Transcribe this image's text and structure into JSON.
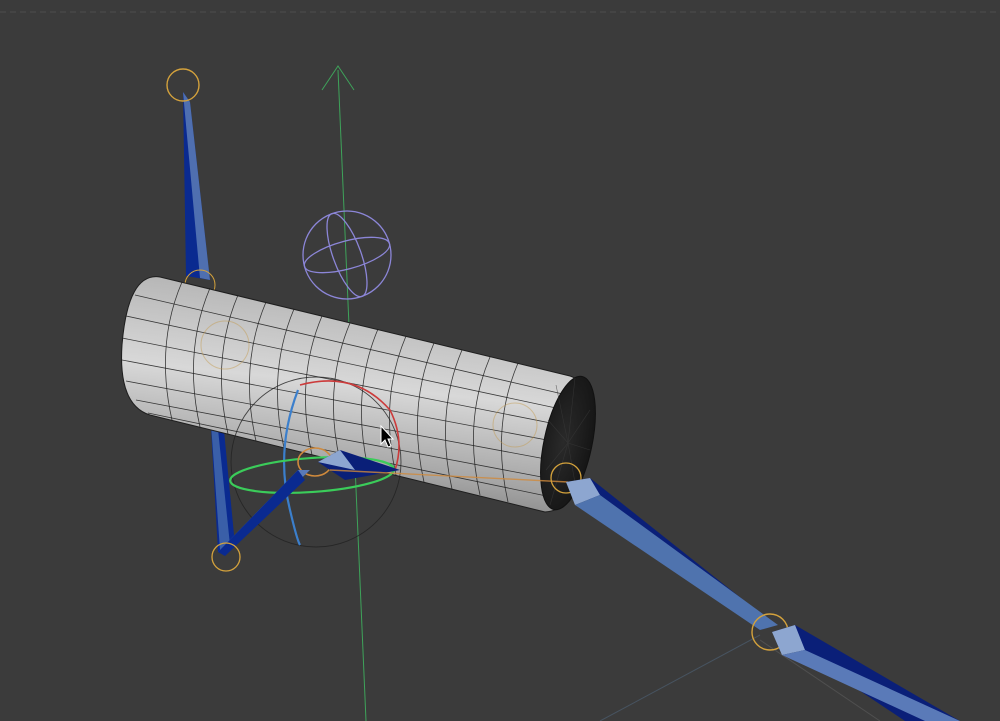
{
  "viewport": {
    "background": "#3b3b3b",
    "horizon_line": "#555555"
  },
  "colors": {
    "mesh_fill": "#9a9a9a",
    "mesh_wire": "#1e1e1e",
    "bone_dark": "#0a1f78",
    "bone_light": "#5c7fb4",
    "joint_ring": "#d4a23c",
    "y_axis": "#3ea35a",
    "rotate_x": "#cc3b3b",
    "rotate_y": "#3bcc5a",
    "rotate_z": "#3b7fcc",
    "controller_sphere": "#8c86d8",
    "ik_line": "#d08a3c",
    "pointer": "#000000"
  },
  "icons": {
    "cursor": "arrow-cursor-icon",
    "null_controller": "sphere-controller-icon",
    "rotate_gizmo": "rotate-gizmo-icon"
  }
}
